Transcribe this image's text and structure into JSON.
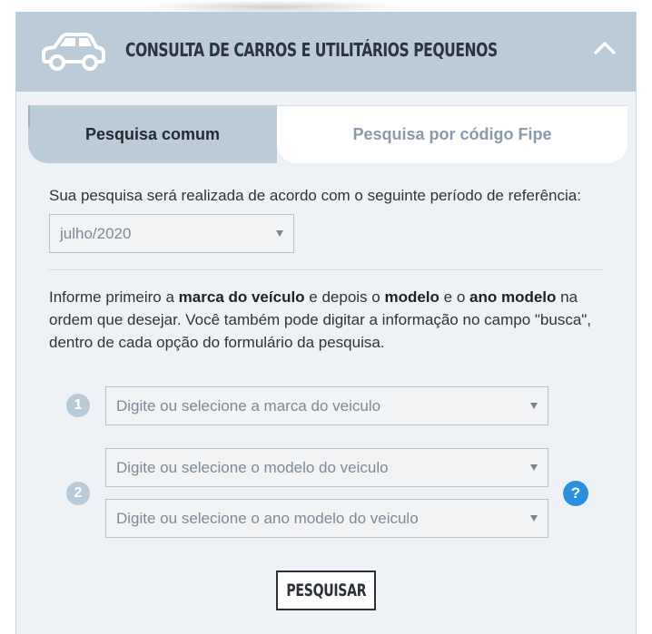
{
  "header": {
    "title": "CONSULTA DE CARROS E UTILITÁRIOS PEQUENOS",
    "icon": "car-icon",
    "collapse_icon": "chevron-up-icon"
  },
  "tabs": [
    {
      "label": "Pesquisa comum",
      "active": true
    },
    {
      "label": "Pesquisa por código Fipe",
      "active": false
    }
  ],
  "period": {
    "label": "Sua pesquisa será realizada de acordo com o seguinte período de referência:",
    "selected": "julho/2020"
  },
  "info": {
    "part1": "Informe primeiro a ",
    "bold1": "marca do veículo",
    "part2": " e depois o ",
    "bold2": "modelo",
    "part3": " e o ",
    "bold3": "ano modelo",
    "part4": " na ordem que desejar. Você também pode digitar a informação no campo \"busca\", dentro de cada opção do formulário da pesquisa."
  },
  "steps": {
    "one": "1",
    "two": "2",
    "brand_placeholder": "Digite ou selecione a marca do veiculo",
    "model_placeholder": "Digite ou selecione o modelo do veiculo",
    "year_placeholder": "Digite ou selecione o ano modelo do veiculo"
  },
  "help": "?",
  "search_button": "PESQUISAR",
  "colors": {
    "header_bg": "#bccbd8",
    "panel_bg": "#eef1f5",
    "help_blue": "#2a8fe0",
    "badge": "#b9cad9"
  }
}
